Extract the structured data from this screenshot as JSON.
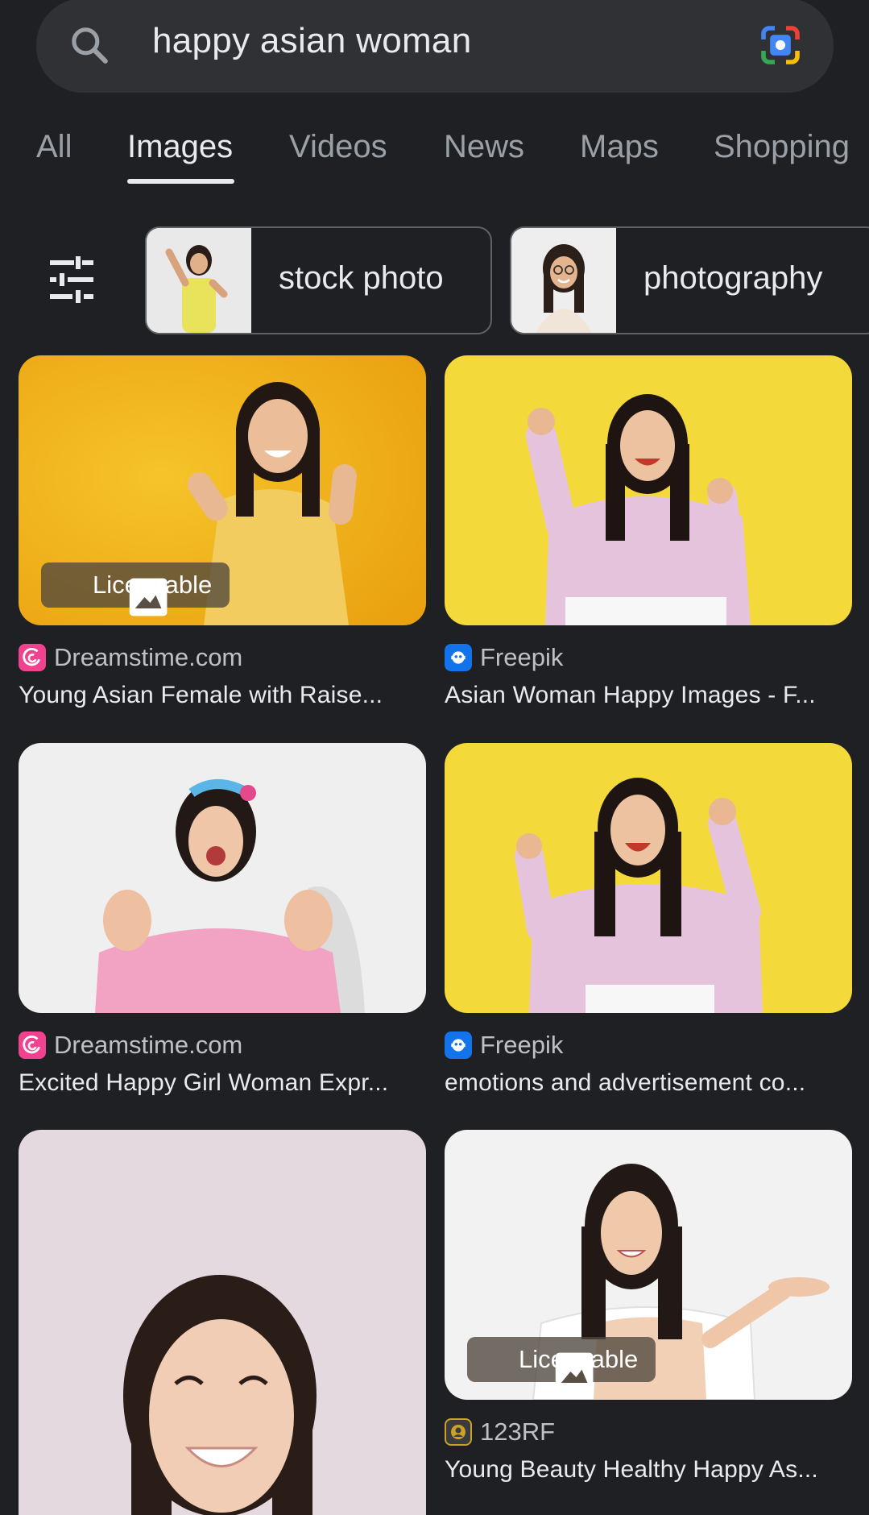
{
  "search": {
    "query": "happy asian woman"
  },
  "tabs": [
    {
      "label": "All"
    },
    {
      "label": "Images"
    },
    {
      "label": "Videos"
    },
    {
      "label": "News"
    },
    {
      "label": "Maps"
    },
    {
      "label": "Shopping"
    }
  ],
  "active_tab": "Images",
  "chips": [
    {
      "label": "stock photo"
    },
    {
      "label": "photography"
    }
  ],
  "results": [
    {
      "source": "Dreamstime.com",
      "title": "Young Asian Female with Raise...",
      "badge": "Licensable",
      "favicon": "dreamstime-icon"
    },
    {
      "source": "Freepik",
      "title": "Asian Woman Happy Images - F...",
      "favicon": "freepik-icon"
    },
    {
      "source": "Dreamstime.com",
      "title": "Excited Happy Girl Woman Expr...",
      "favicon": "dreamstime-icon"
    },
    {
      "source": "Freepik",
      "title": "emotions and advertisement co...",
      "favicon": "freepik-icon"
    },
    {
      "source": "",
      "title": "",
      "favicon": ""
    },
    {
      "source": "123RF",
      "title": "Young Beauty Healthy Happy As...",
      "badge": "Licensable",
      "favicon": "123rf-icon"
    }
  ],
  "colors": {
    "background": "#1f2023",
    "search_bar": "#303134",
    "text_primary": "#e8eaed",
    "text_secondary": "#9aa0a6",
    "dreamstime": "#f0428e",
    "freepik": "#1273eb"
  }
}
